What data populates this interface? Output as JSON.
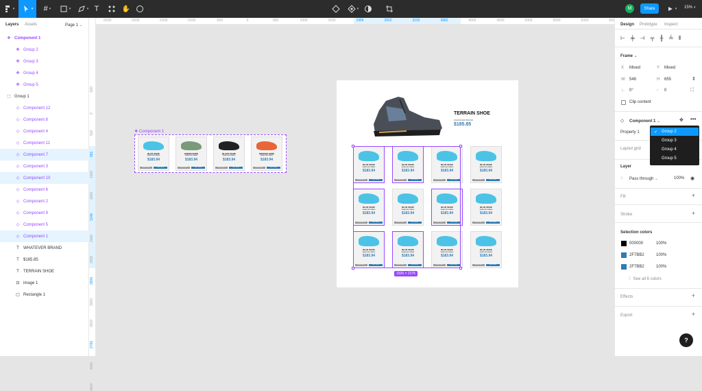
{
  "toolbar": {
    "zoom": "15%",
    "share": "Share",
    "avatar": "M"
  },
  "left": {
    "tab_layers": "Layers",
    "tab_assets": "Assets",
    "page": "Page 1",
    "layers": [
      {
        "label": "Component 1",
        "kind": "component-set",
        "indent": 0,
        "selected": false
      },
      {
        "label": "Group 2",
        "kind": "variant",
        "indent": 1,
        "selected": false
      },
      {
        "label": "Group 3",
        "kind": "variant",
        "indent": 1,
        "selected": false
      },
      {
        "label": "Group 4",
        "kind": "variant",
        "indent": 1,
        "selected": false
      },
      {
        "label": "Group 5",
        "kind": "variant",
        "indent": 1,
        "selected": false
      },
      {
        "label": "Group 1",
        "kind": "frame",
        "indent": 0,
        "selected": false
      },
      {
        "label": "Component 12",
        "kind": "instance",
        "indent": 1,
        "selected": false
      },
      {
        "label": "Component 8",
        "kind": "instance",
        "indent": 1,
        "selected": false
      },
      {
        "label": "Component 4",
        "kind": "instance",
        "indent": 1,
        "selected": false
      },
      {
        "label": "Component 11",
        "kind": "instance",
        "indent": 1,
        "selected": false
      },
      {
        "label": "Component 7",
        "kind": "instance",
        "indent": 1,
        "selected": true
      },
      {
        "label": "Component 3",
        "kind": "instance",
        "indent": 1,
        "selected": false
      },
      {
        "label": "Component 10",
        "kind": "instance",
        "indent": 1,
        "selected": true
      },
      {
        "label": "Component 6",
        "kind": "instance",
        "indent": 1,
        "selected": false
      },
      {
        "label": "Component 2",
        "kind": "instance",
        "indent": 1,
        "selected": false
      },
      {
        "label": "Component 9",
        "kind": "instance",
        "indent": 1,
        "selected": false
      },
      {
        "label": "Component 5",
        "kind": "instance",
        "indent": 1,
        "selected": false
      },
      {
        "label": "Component 1",
        "kind": "instance",
        "indent": 1,
        "selected": true
      },
      {
        "label": "WHATEVER BRAND",
        "kind": "text",
        "indent": 1,
        "selected": false
      },
      {
        "label": "$185.85",
        "kind": "text",
        "indent": 1,
        "selected": false
      },
      {
        "label": "TERRAIN SHOE",
        "kind": "text",
        "indent": 1,
        "selected": false
      },
      {
        "label": "image 1",
        "kind": "image",
        "indent": 1,
        "selected": false
      },
      {
        "label": "Rectangle 1",
        "kind": "rect",
        "indent": 1,
        "selected": false
      }
    ]
  },
  "rulers": {
    "top": [
      "-2500",
      "-2000",
      "-1500",
      "-1000",
      "-500",
      "0",
      "500",
      "1000",
      "1500",
      "1956",
      "2502",
      "3192",
      "3882",
      "4000",
      "4500",
      "5000",
      "5500",
      "6000",
      "6500"
    ],
    "left": [
      "-500",
      "0",
      "500",
      "581",
      "1000",
      "1500",
      "1246",
      "2000",
      "2500",
      "2906",
      "3000",
      "3500",
      "2766",
      "4000",
      "4500"
    ]
  },
  "canvas": {
    "component_label": "Component 1",
    "size_label": "1926 × 2175",
    "variants": [
      {
        "name": "BLUE SHOE",
        "color": "#4cc3e6"
      },
      {
        "name": "GREEN SHOE",
        "color": "#7a9a7a"
      },
      {
        "name": "BLACK SHOE",
        "color": "#222"
      },
      {
        "name": "ORANGE SHOE",
        "color": "#e8663a"
      }
    ],
    "card": {
      "name": "BLUE SHOE",
      "sub": "WHATEVER BRAND",
      "price": "$183.94",
      "btn_left": "MORE INFO",
      "btn_right": "BUY NOW"
    },
    "hero": {
      "title": "TERRAIN SHOE",
      "brand": "WHATEVER BRAND",
      "price": "$185.85"
    }
  },
  "right": {
    "tab_design": "Design",
    "tab_prototype": "Prototype",
    "tab_inspect": "Inspect",
    "frame": "Frame",
    "x_label": "X",
    "x_val": "Mixed",
    "y_label": "Y",
    "y_val": "Mixed",
    "w_label": "W",
    "w_val": "546",
    "h_label": "H",
    "h_val": "655",
    "rot_val": "0°",
    "rad_val": "0",
    "clip": "Clip content",
    "component": "Component 1",
    "property": "Property 1",
    "options": [
      "Group 2",
      "Group 3",
      "Group 4",
      "Group 5"
    ],
    "layout_grid": "Layout grid",
    "layer": "Layer",
    "pass": "Pass through",
    "opacity": "100%",
    "fill": "Fill",
    "stroke": "Stroke",
    "sel_colors": "Selection colors",
    "colors": [
      {
        "hex": "000000",
        "pct": "100%",
        "color": "#000000"
      },
      {
        "hex": "2F7BB2",
        "pct": "100%",
        "color": "#2f7bb2"
      },
      {
        "hex": "2F7BB2",
        "pct": "100%",
        "color": "#2f7bb2"
      }
    ],
    "see_all": "See all 6 colors",
    "effects": "Effects",
    "export": "Export"
  },
  "help": "?"
}
